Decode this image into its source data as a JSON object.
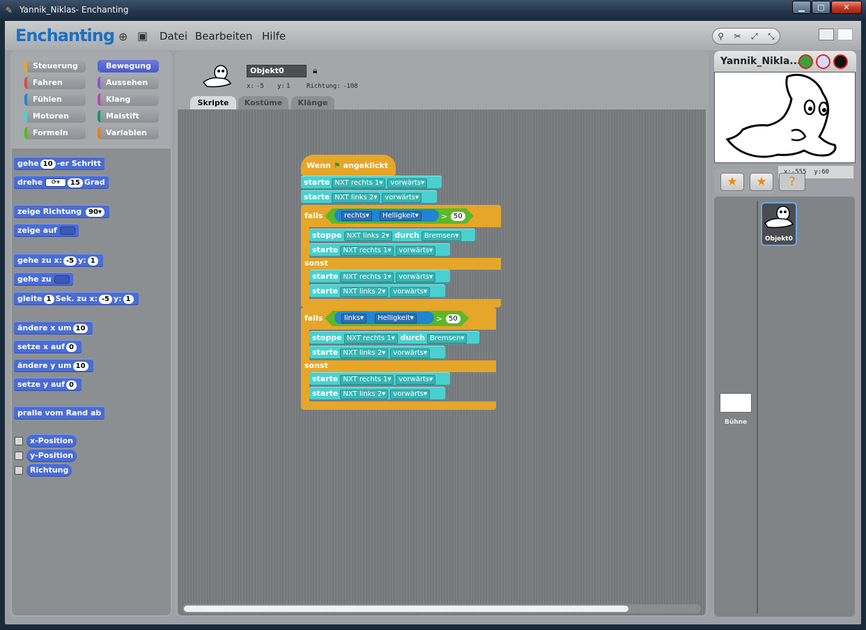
{
  "window": {
    "title": "Yannik_Niklas- Enchanting",
    "buttons": {
      "minimize": "▁",
      "maximize": "▢",
      "close": "✕"
    }
  },
  "app": {
    "logo": "Enchanting",
    "menu": [
      "Datei",
      "Bearbeiten",
      "Hilfe"
    ]
  },
  "categories": [
    {
      "label": "Steuerung",
      "color": "#e6a629",
      "selected": false
    },
    {
      "label": "Bewegung",
      "color": "#4a6cd4",
      "selected": true
    },
    {
      "label": "Fahren",
      "color": "#d94f3d",
      "selected": false
    },
    {
      "label": "Aussehen",
      "color": "#8a55d7",
      "selected": false
    },
    {
      "label": "Fühlen",
      "color": "#2185d0",
      "selected": false
    },
    {
      "label": "Klang",
      "color": "#bb42c3",
      "selected": false
    },
    {
      "label": "Motoren",
      "color": "#4ad0d0",
      "selected": false
    },
    {
      "label": "Malstift",
      "color": "#0e9a6c",
      "selected": false
    },
    {
      "label": "Formeln",
      "color": "#5cb712",
      "selected": false
    },
    {
      "label": "Variablen",
      "color": "#ee7d16",
      "selected": false
    }
  ],
  "palette": {
    "gehe_pre": "gehe",
    "gehe_val": "10",
    "gehe_post": "-er Schritt",
    "drehe_pre": "drehe",
    "drehe_val": "15",
    "drehe_post": "Grad",
    "zeige_richtung": "zeige Richtung",
    "zeige_richtung_val": "90▾",
    "zeige_auf": "zeige auf",
    "gehe_zu_x": "gehe zu x:",
    "gehe_zu_x_val": "-5",
    "gehe_zu_y": "y:",
    "gehe_zu_y_val": "1",
    "gehe_zu": "gehe zu",
    "gleite": "gleite",
    "gleite_val": "1",
    "gleite_mid": "Sek. zu x:",
    "gleite_x": "-5",
    "gleite_y_lbl": "y:",
    "gleite_y": "1",
    "aendere_x": "ändere x um",
    "aendere_x_val": "10",
    "setze_x": "setze x auf",
    "setze_x_val": "0",
    "aendere_y": "ändere y um",
    "aendere_y_val": "10",
    "setze_y": "setze y auf",
    "setze_y_val": "0",
    "pralle": "pralle vom Rand ab",
    "reporters": [
      "x-Position",
      "y-Position",
      "Richtung"
    ]
  },
  "sprite": {
    "name": "Objekt0",
    "x_label": "x:",
    "x": "-5",
    "y_label": "y:",
    "y": "1",
    "dir_label": "Richtung:",
    "dir": "-108"
  },
  "tabs": [
    "Skripte",
    "Kostüme",
    "Klänge"
  ],
  "script": {
    "hat_pre": "Wenn",
    "hat_post": "angeklickt",
    "starte": "starte",
    "stoppe": "stoppe",
    "durch": "durch",
    "falls": "falls",
    "sonst": "sonst",
    "nxt_r": "NXT rechts 1",
    "nxt_l": "NXT links 2",
    "vorwaerts": "vorwärts",
    "bremsen": "Bremsen",
    "rechts": "rechts",
    "links": "links",
    "helligkeit": "Helligkeit",
    "gt": ">",
    "threshold": "50"
  },
  "stage": {
    "title": "Yannik_Nikla...",
    "mouse_x_label": "x:",
    "mouse_x": "-555",
    "mouse_y_label": "y:",
    "mouse_y": "60"
  },
  "sprites_panel": {
    "stage_label": "Bühne",
    "sprite_label": "Objekt0"
  }
}
